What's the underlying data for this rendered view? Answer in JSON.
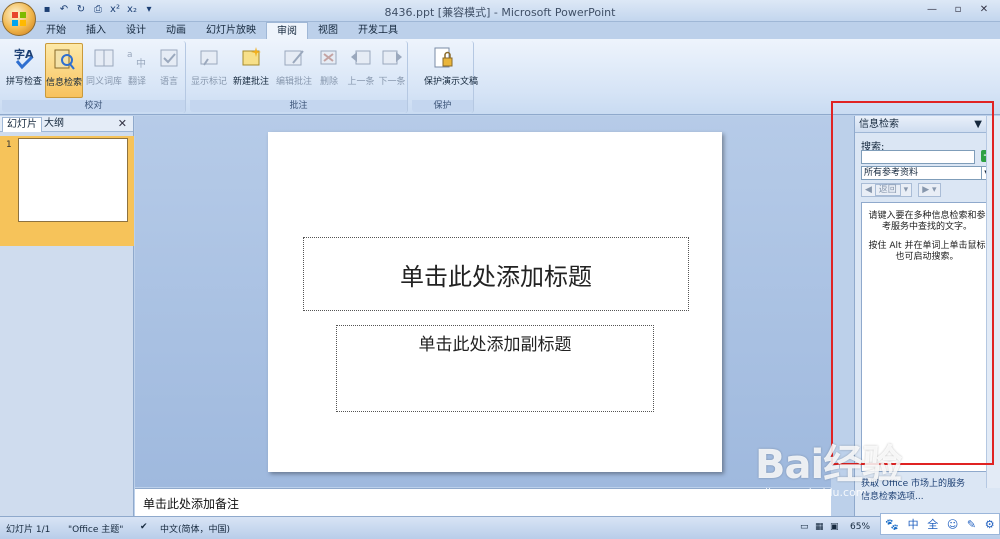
{
  "app": {
    "title": "8436.ppt [兼容模式] - Microsoft PowerPoint",
    "qat_icons": [
      "save-icon",
      "undo-icon",
      "redo-icon",
      "print-preview-icon",
      "superscript-icon",
      "subscript-icon",
      "customize-qat-icon"
    ],
    "window_buttons": [
      "—",
      "▫",
      "✕"
    ]
  },
  "ribbon": {
    "tabs": [
      "开始",
      "插入",
      "设计",
      "动画",
      "幻灯片放映",
      "审阅",
      "视图",
      "开发工具"
    ],
    "active_tab": "审阅",
    "groups": {
      "proofing": {
        "label": "校对",
        "buttons": [
          "拼写检查",
          "信息检索",
          "同义词库",
          "翻译",
          "语言"
        ]
      },
      "comments": {
        "label": "批注",
        "buttons": [
          "显示标记",
          "新建批注",
          "编辑批注",
          "删除",
          "上一条",
          "下一条"
        ]
      },
      "protect": {
        "label": "保护",
        "buttons": [
          "保护演示文稿"
        ]
      }
    }
  },
  "slide_pane": {
    "tabs": [
      "幻灯片",
      "大纲"
    ],
    "thumb_number": "1"
  },
  "slide": {
    "title_placeholder": "单击此处添加标题",
    "subtitle_placeholder": "单击此处添加副标题"
  },
  "notes": {
    "placeholder": "单击此处添加备注"
  },
  "research": {
    "title": "信息检索",
    "search_label": "搜索:",
    "search_value": "",
    "source_selected": "所有参考资料",
    "back_label": "返回",
    "results_text_1": "请键入要在多种信息检索和参考服务中查找的文字。",
    "results_text_2": "按住 Alt 并在单词上单击鼠标也可启动搜索。",
    "footer_1": "获取 Office 市场上的服务",
    "footer_2": "信息检索选项..."
  },
  "status": {
    "slide_pos": "幻灯片 1/1",
    "theme": "\"Office 主题\"",
    "language": "中文(简体，中国)",
    "zoom": "65%"
  },
  "watermark": {
    "brand": "Bai经验",
    "url": "jingyan.baidu.com"
  },
  "ime": [
    "中",
    "全",
    "☺",
    "✎",
    "⚙"
  ],
  "colors": {
    "highlight_frame": "#e02323",
    "pressed_button": "#f8c25d",
    "ribbon_bg": "#d6e4f6"
  }
}
